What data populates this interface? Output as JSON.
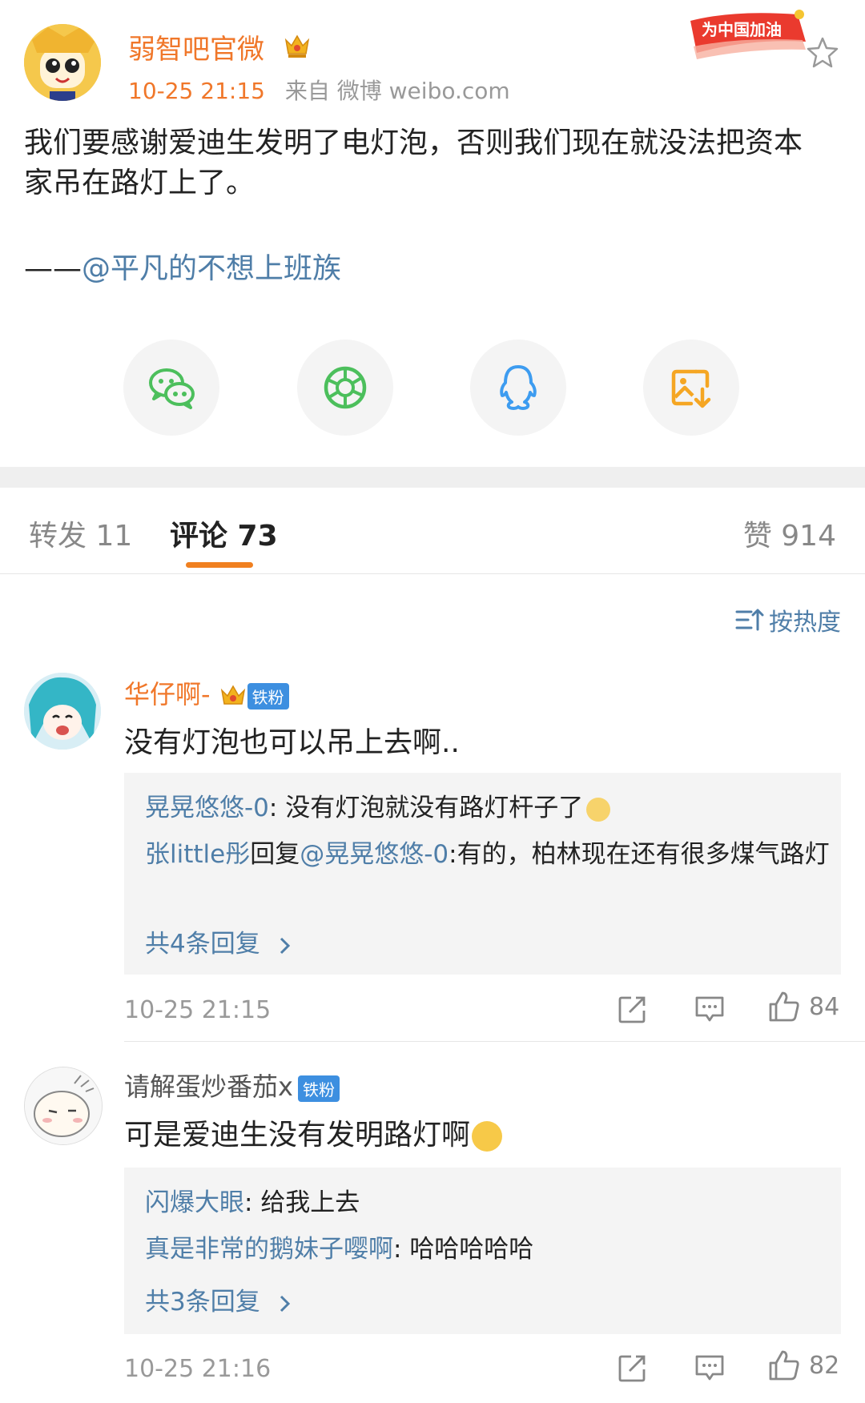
{
  "post": {
    "author": "弱智吧官微",
    "time": "10-25 21:15",
    "source": "来自 微博 weibo.com",
    "badge_text": "为中国加油",
    "text": "我们要感谢爱迪生发明了电灯泡，否则我们现在就没法把资本家吊在路灯上了。",
    "signature_prefix": "——",
    "signature_mention": "@平凡的不想上班族"
  },
  "share": [
    "wechat-icon",
    "moments-icon",
    "qq-icon",
    "save-image-icon"
  ],
  "tabs": {
    "repost": "转发 11",
    "comments": "评论 73",
    "likes": "赞 914"
  },
  "sort_label": "按热度",
  "comments": [
    {
      "name": "华仔啊-",
      "fan_badge": "铁粉",
      "text": "没有灯泡也可以吊上去啊..",
      "replies": [
        {
          "user": "晃晃悠悠-0",
          "sep": ": ",
          "text": "没有灯泡就没有路灯杆子了"
        },
        {
          "user": "张little彤",
          "mid": "回复",
          "mention": "@晃晃悠悠-0",
          "sep": ":",
          "text": "有的，柏林现在还有很多煤气路灯"
        }
      ],
      "more": "共4条回复",
      "time": "10-25 21:15",
      "likes": "84"
    },
    {
      "name": "请解蛋炒番茄x",
      "fan_badge": "铁粉",
      "text": "可是爱迪生没有发明路灯啊",
      "replies": [
        {
          "user": "闪爆大眼",
          "sep": ": ",
          "text": "给我上去"
        },
        {
          "user": "真是非常的鹅妹子嘤啊",
          "sep": ": ",
          "text": "哈哈哈哈哈"
        }
      ],
      "more": "共3条回复",
      "time": "10-25 21:16",
      "likes": "82"
    }
  ],
  "colors": {
    "accent_orange": "#f0772a",
    "link_blue": "#4f7ea8",
    "tab_underline": "#f08020",
    "fan_badge": "#3d8fe0"
  }
}
